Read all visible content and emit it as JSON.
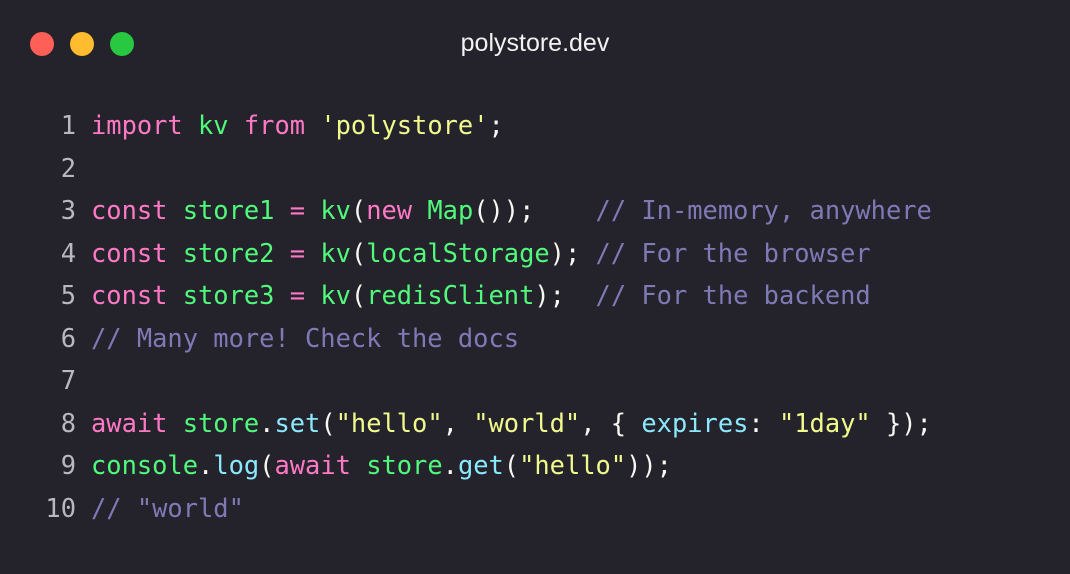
{
  "window": {
    "title": "polystore.dev",
    "controls": {
      "close_color": "#fe5f57",
      "minimize_color": "#febc2e",
      "zoom_color": "#28c840"
    }
  },
  "theme": {
    "background": "#24222b",
    "keyword": "#ff79c6",
    "identifier": "#50fa7b",
    "string": "#f1fa8c",
    "function": "#8be9fd",
    "comment": "#7f7ab6",
    "plain": "#f8f8f2",
    "line_number": "#b9b7c0"
  },
  "code": {
    "lines": [
      {
        "number": "1",
        "tokens": [
          {
            "t": "kw",
            "v": "import"
          },
          {
            "t": "pl",
            "v": " "
          },
          {
            "t": "id",
            "v": "kv"
          },
          {
            "t": "pl",
            "v": " "
          },
          {
            "t": "kw",
            "v": "from"
          },
          {
            "t": "pl",
            "v": " "
          },
          {
            "t": "str",
            "v": "'polystore'"
          },
          {
            "t": "pl",
            "v": ";"
          }
        ]
      },
      {
        "number": "2",
        "tokens": []
      },
      {
        "number": "3",
        "tokens": [
          {
            "t": "kw",
            "v": "const"
          },
          {
            "t": "pl",
            "v": " "
          },
          {
            "t": "id",
            "v": "store1"
          },
          {
            "t": "pl",
            "v": " "
          },
          {
            "t": "kw",
            "v": "="
          },
          {
            "t": "pl",
            "v": " "
          },
          {
            "t": "id",
            "v": "kv"
          },
          {
            "t": "pl",
            "v": "("
          },
          {
            "t": "kw",
            "v": "new"
          },
          {
            "t": "pl",
            "v": " "
          },
          {
            "t": "id",
            "v": "Map"
          },
          {
            "t": "pl",
            "v": "());    "
          },
          {
            "t": "cm",
            "v": "// In-memory, anywhere"
          }
        ]
      },
      {
        "number": "4",
        "tokens": [
          {
            "t": "kw",
            "v": "const"
          },
          {
            "t": "pl",
            "v": " "
          },
          {
            "t": "id",
            "v": "store2"
          },
          {
            "t": "pl",
            "v": " "
          },
          {
            "t": "kw",
            "v": "="
          },
          {
            "t": "pl",
            "v": " "
          },
          {
            "t": "id",
            "v": "kv"
          },
          {
            "t": "pl",
            "v": "("
          },
          {
            "t": "id",
            "v": "localStorage"
          },
          {
            "t": "pl",
            "v": "); "
          },
          {
            "t": "cm",
            "v": "// For the browser"
          }
        ]
      },
      {
        "number": "5",
        "tokens": [
          {
            "t": "kw",
            "v": "const"
          },
          {
            "t": "pl",
            "v": " "
          },
          {
            "t": "id",
            "v": "store3"
          },
          {
            "t": "pl",
            "v": " "
          },
          {
            "t": "kw",
            "v": "="
          },
          {
            "t": "pl",
            "v": " "
          },
          {
            "t": "id",
            "v": "kv"
          },
          {
            "t": "pl",
            "v": "("
          },
          {
            "t": "id",
            "v": "redisClient"
          },
          {
            "t": "pl",
            "v": ");  "
          },
          {
            "t": "cm",
            "v": "// For the backend"
          }
        ]
      },
      {
        "number": "6",
        "tokens": [
          {
            "t": "cm",
            "v": "// Many more! Check the docs"
          }
        ]
      },
      {
        "number": "7",
        "tokens": []
      },
      {
        "number": "8",
        "tokens": [
          {
            "t": "kw",
            "v": "await"
          },
          {
            "t": "pl",
            "v": " "
          },
          {
            "t": "id",
            "v": "store"
          },
          {
            "t": "pl",
            "v": "."
          },
          {
            "t": "fn",
            "v": "set"
          },
          {
            "t": "pl",
            "v": "("
          },
          {
            "t": "str",
            "v": "\"hello\""
          },
          {
            "t": "pl",
            "v": ", "
          },
          {
            "t": "str",
            "v": "\"world\""
          },
          {
            "t": "pl",
            "v": ", { "
          },
          {
            "t": "prop",
            "v": "expires"
          },
          {
            "t": "pl",
            "v": ": "
          },
          {
            "t": "str",
            "v": "\"1day\""
          },
          {
            "t": "pl",
            "v": " });"
          }
        ]
      },
      {
        "number": "9",
        "tokens": [
          {
            "t": "id",
            "v": "console"
          },
          {
            "t": "pl",
            "v": "."
          },
          {
            "t": "fn",
            "v": "log"
          },
          {
            "t": "pl",
            "v": "("
          },
          {
            "t": "kw",
            "v": "await"
          },
          {
            "t": "pl",
            "v": " "
          },
          {
            "t": "id",
            "v": "store"
          },
          {
            "t": "pl",
            "v": "."
          },
          {
            "t": "fn",
            "v": "get"
          },
          {
            "t": "pl",
            "v": "("
          },
          {
            "t": "str",
            "v": "\"hello\""
          },
          {
            "t": "pl",
            "v": "));"
          }
        ]
      },
      {
        "number": "10",
        "tokens": [
          {
            "t": "cm",
            "v": "// \"world\""
          }
        ]
      }
    ]
  }
}
